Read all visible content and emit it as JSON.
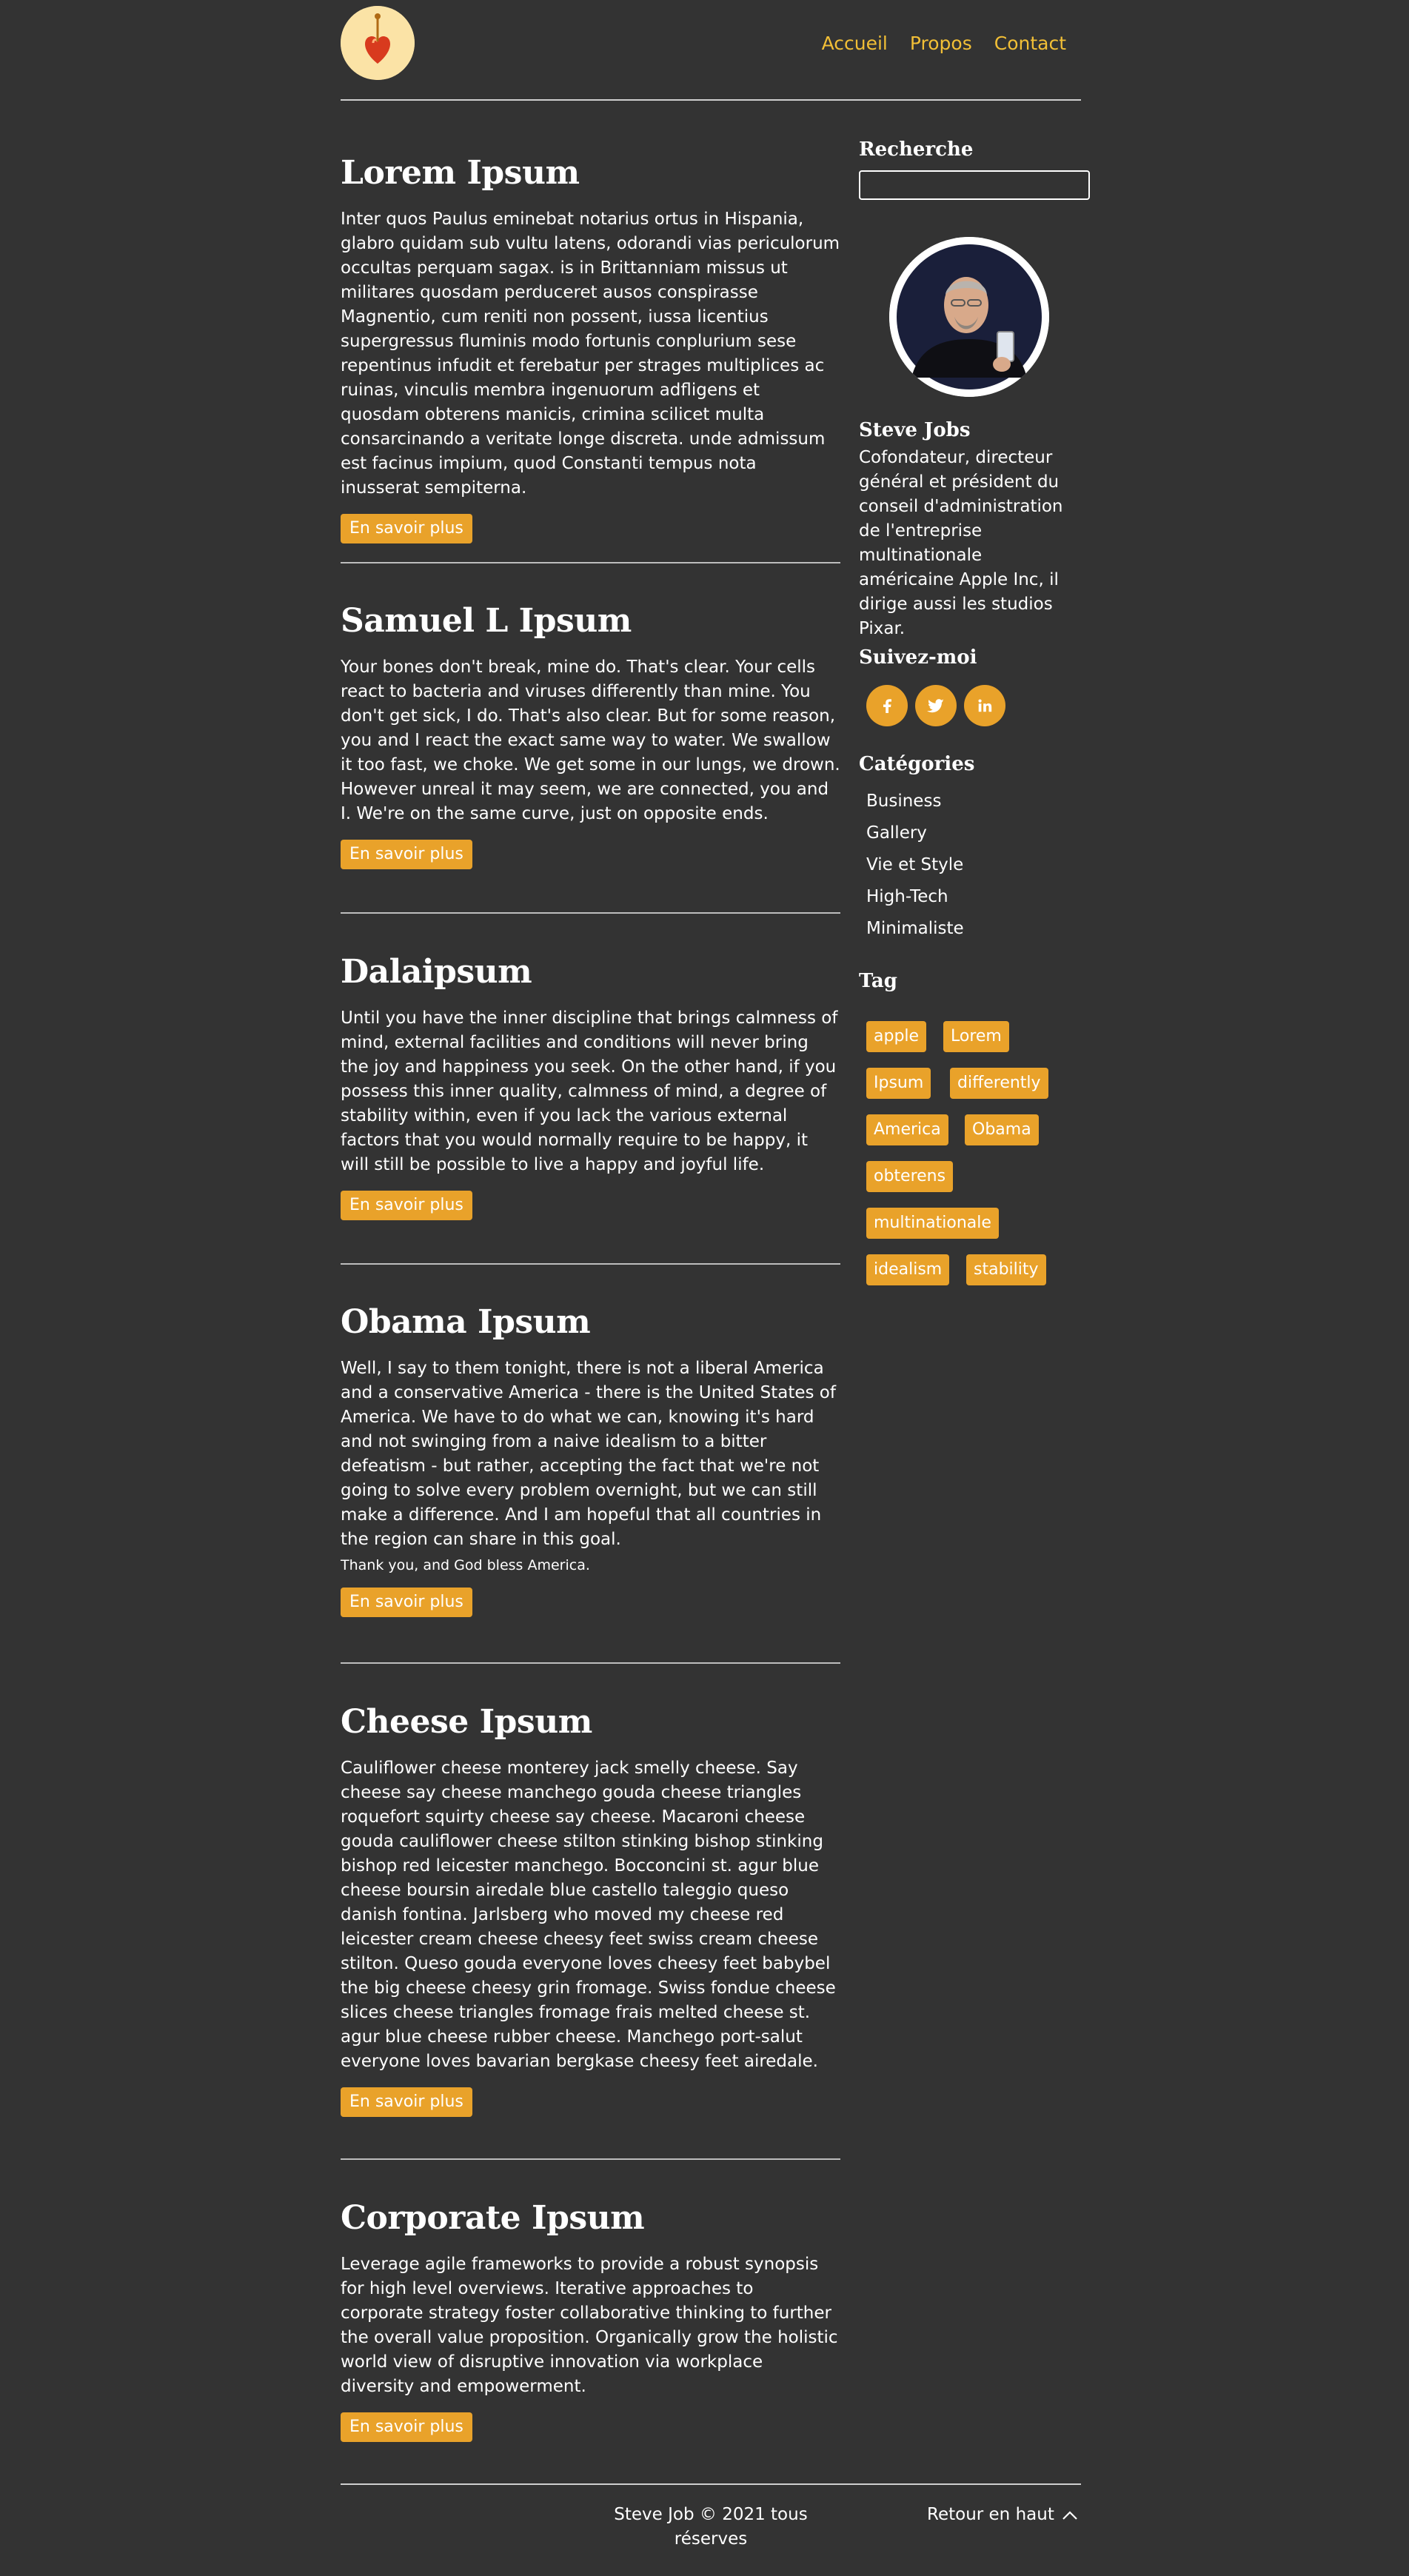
{
  "nav": {
    "items": [
      "Accueil",
      "Propos",
      "Contact"
    ]
  },
  "posts": [
    {
      "title": "Lorem Ipsum",
      "body": "Inter quos Paulus eminebat notarius ortus in Hispania, glabro quidam sub vultu latens, odorandi vias periculorum occultas perquam sagax. is in Brittanniam missus ut militares quosdam perduceret ausos conspirasse Magnentio, cum reniti non possent, iussa licentius supergressus fluminis modo fortunis conplurium sese repentinus infudit et ferebatur per strages multiplices ac ruinas, vinculis membra ingenuorum adfligens et quosdam obterens manicis, crimina scilicet multa consarcinando a veritate longe discreta. unde admissum est facinus impium, quod Constanti tempus nota inusserat sempiterna.",
      "button": "En savoir plus"
    },
    {
      "title": "Samuel L Ipsum",
      "body": "Your bones don't break, mine do. That's clear. Your cells react to bacteria and viruses differently than mine. You don't get sick, I do. That's also clear. But for some reason, you and I react the exact same way to water. We swallow it too fast, we choke. We get some in our lungs, we drown. However unreal it may seem, we are connected, you and I. We're on the same curve, just on opposite ends.",
      "button": "En savoir plus"
    },
    {
      "title": "Dalaipsum",
      "body": "Until you have the inner discipline that brings calmness of mind, external facilities and conditions will never bring the joy and happiness you seek. On the other hand, if you possess this inner quality, calmness of mind, a degree of stability within, even if you lack the various external factors that you would normally require to be happy, it will still be possible to live a happy and joyful life.",
      "button": "En savoir plus"
    },
    {
      "title": "Obama Ipsum",
      "body": "Well, I say to them tonight, there is not a liberal America and a conservative America - there is the United States of America. We have to do what we can, knowing it's hard and not swinging from a naive idealism to a bitter defeatism - but rather, accepting the fact that we're not going to solve every problem overnight, but we can still make a difference. And I am hopeful that all countries in the region can share in this goal.",
      "extra": "Thank you, and God bless America.",
      "button": "En savoir plus"
    },
    {
      "title": "Cheese Ipsum",
      "body": "Cauliflower cheese monterey jack smelly cheese. Say cheese say cheese manchego gouda cheese triangles roquefort squirty cheese say cheese. Macaroni cheese gouda cauliflower cheese stilton stinking bishop stinking bishop red leicester manchego. Bocconcini st. agur blue cheese boursin airedale blue castello taleggio queso danish fontina. Jarlsberg who moved my cheese red leicester cream cheese cheesy feet swiss cream cheese stilton. Queso gouda everyone loves cheesy feet babybel the big cheese cheesy grin fromage. Swiss fondue cheese slices cheese triangles fromage frais melted cheese st. agur blue cheese rubber cheese. Manchego port-salut everyone loves bavarian bergkase cheesy feet airedale.",
      "button": "En savoir plus"
    },
    {
      "title": "Corporate Ipsum",
      "body": "Leverage agile frameworks to provide a robust synopsis for high level overviews. Iterative approaches to corporate strategy foster collaborative thinking to further the overall value proposition. Organically grow the holistic world view of disruptive innovation via workplace diversity and empowerment.",
      "button": "En savoir plus"
    }
  ],
  "sidebar": {
    "search_title": "Recherche",
    "search_value": "",
    "author_name": "Steve Jobs",
    "author_bio": "Cofondateur, directeur général et président du conseil d'administration de l'entreprise multinationale américaine Apple Inc, il dirige aussi les studios Pixar.",
    "follow_title": "Suivez-moi",
    "social": [
      "facebook-icon",
      "twitter-icon",
      "linkedin-icon"
    ],
    "categories_title": "Catégories",
    "categories": [
      "Business",
      "Gallery",
      "Vie et Style",
      "High-Tech",
      "Minimaliste"
    ],
    "tag_title": "Tag",
    "tags": [
      "apple",
      "Lorem",
      "Ipsum",
      "differently",
      "America",
      "Obama",
      "obterens",
      "multinationale",
      "idealism",
      "stability"
    ]
  },
  "footer": {
    "copyright": "Steve Job © 2021 tous réserves",
    "back_to_top": "Retour en haut"
  },
  "colors": {
    "background": "#333333",
    "accent": "#e9a22a",
    "nav_link": "#f2bf36"
  }
}
